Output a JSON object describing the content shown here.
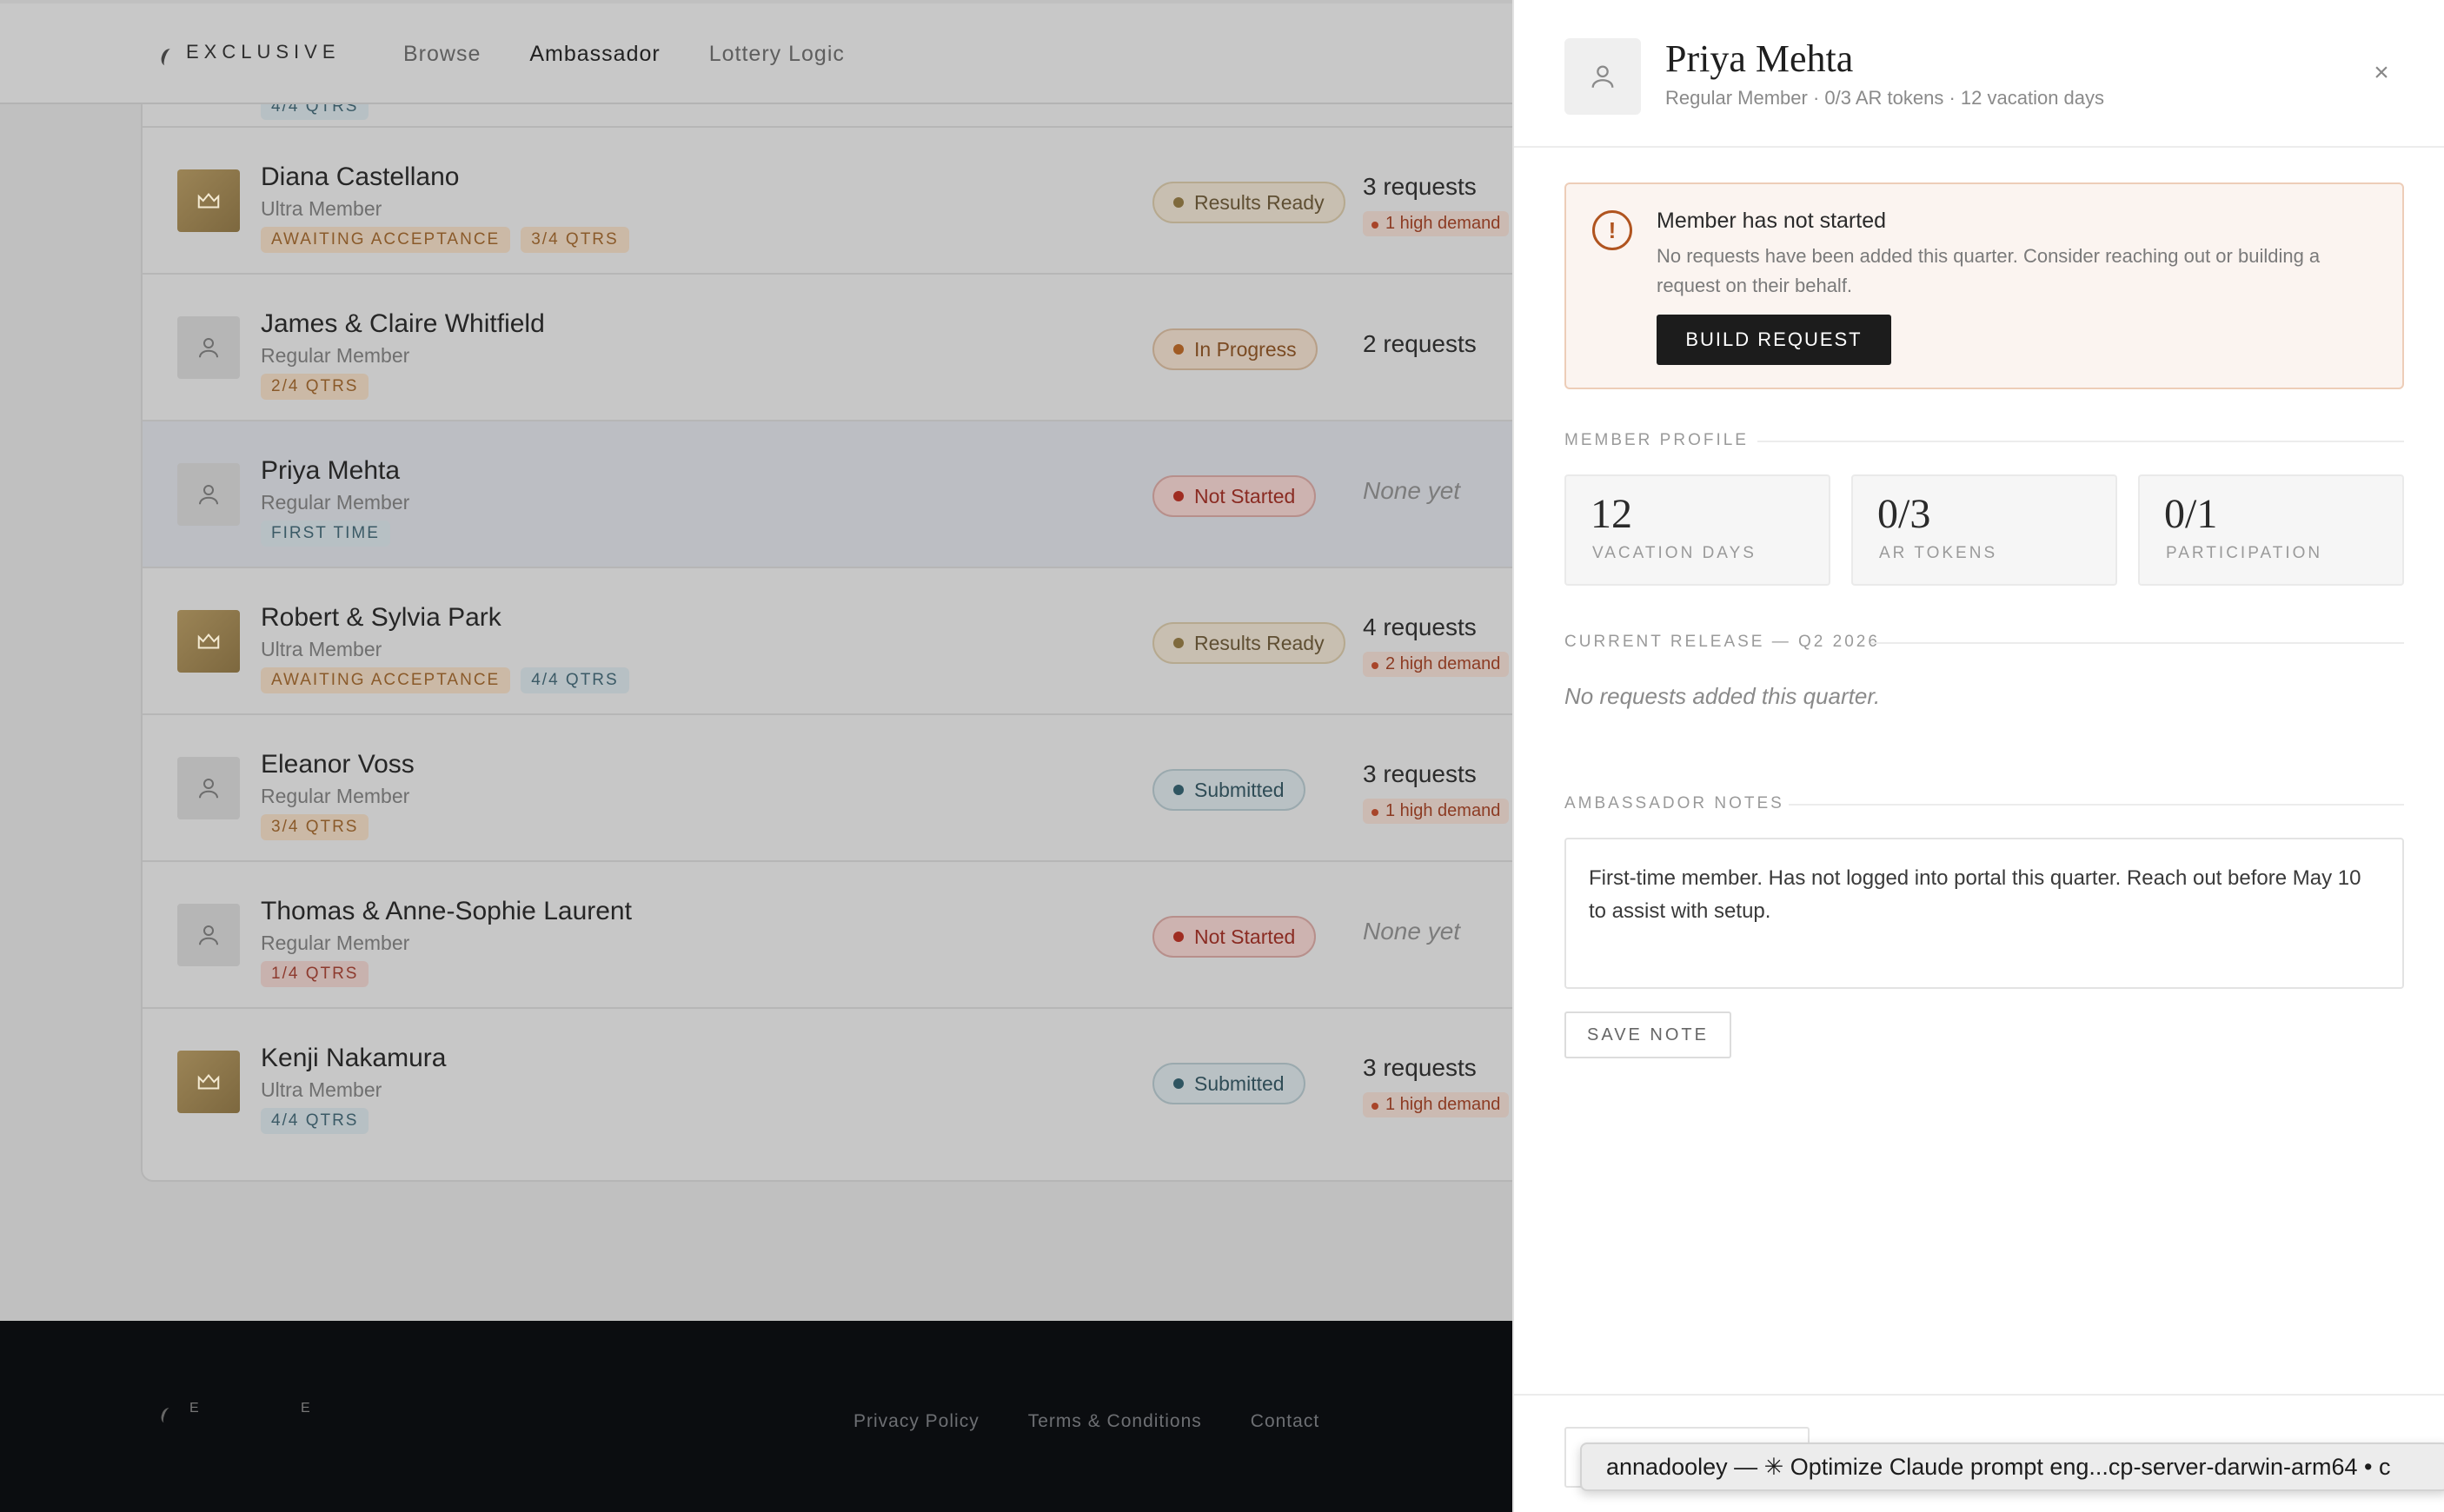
{
  "brand": {
    "name": "EXCLUSIVE"
  },
  "nav": {
    "links": [
      "Browse",
      "Ambassador",
      "Lottery Logic"
    ],
    "active": "Ambassador"
  },
  "top_partial_row": {
    "tag": "4/4 QTRS"
  },
  "members": [
    {
      "name": "Diana Castellano",
      "tier": "Ultra Member",
      "tags": [
        "AWAITING ACCEPTANCE",
        "3/4 QTRS"
      ],
      "status": "Results Ready",
      "requests": "3 requests",
      "high_demand": "1 high demand"
    },
    {
      "name": "James & Claire Whitfield",
      "tier": "Regular Member",
      "tags": [
        "2/4 QTRS"
      ],
      "status": "In Progress",
      "requests": "2 requests",
      "high_demand": ""
    },
    {
      "name": "Priya Mehta",
      "tier": "Regular Member",
      "tags": [
        "FIRST TIME"
      ],
      "status": "Not Started",
      "requests": "None yet",
      "high_demand": ""
    },
    {
      "name": "Robert & Sylvia Park",
      "tier": "Ultra Member",
      "tags": [
        "AWAITING ACCEPTANCE",
        "4/4 QTRS"
      ],
      "status": "Results Ready",
      "requests": "4 requests",
      "high_demand": "2 high demand"
    },
    {
      "name": "Eleanor Voss",
      "tier": "Regular Member",
      "tags": [
        "3/4 QTRS"
      ],
      "status": "Submitted",
      "requests": "3 requests",
      "high_demand": "1 high demand"
    },
    {
      "name": "Thomas & Anne-Sophie Laurent",
      "tier": "Regular Member",
      "tags": [
        "1/4 QTRS"
      ],
      "status": "Not Started",
      "requests": "None yet",
      "high_demand": ""
    },
    {
      "name": "Kenji Nakamura",
      "tier": "Ultra Member",
      "tags": [
        "4/4 QTRS"
      ],
      "status": "Submitted",
      "requests": "3 requests",
      "high_demand": "1 high demand"
    }
  ],
  "footer": {
    "letters": [
      "E",
      "E"
    ],
    "links": [
      "Privacy Policy",
      "Terms & Conditions",
      "Contact"
    ]
  },
  "drawer": {
    "name": "Priya Mehta",
    "subtitle": "Regular Member · 0/3 AR tokens · 12 vacation days",
    "close": "×",
    "alert": {
      "title": "Member has not started",
      "text": "No requests have been added this quarter. Consider reaching out or building a request on their behalf.",
      "button": "BUILD REQUEST"
    },
    "profile_label": "MEMBER PROFILE",
    "stats": [
      {
        "value": "12",
        "label": "VACATION DAYS"
      },
      {
        "value": "0/3",
        "label": "AR TOKENS"
      },
      {
        "value": "0/1",
        "label": "PARTICIPATION"
      }
    ],
    "release_label": "CURRENT RELEASE — Q2 2026",
    "release_empty": "No requests added this quarter.",
    "notes_label": "AMBASSADOR NOTES",
    "notes_text": "First-time member. Has not logged into portal this quarter. Reach out before May 10 to assist with setup.",
    "save_button": "SAVE NOTE"
  },
  "os_tooltip": "annadooley — ✳ Optimize Claude prompt eng...cp-server-darwin-arm64 • c"
}
